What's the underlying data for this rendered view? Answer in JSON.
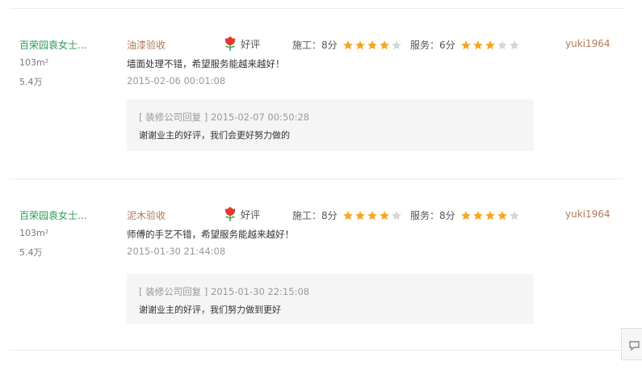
{
  "reviews": [
    {
      "owner_name": "百荣园袁女士...",
      "area": "103m²",
      "budget": "5.4万",
      "stage": "油漆验收",
      "rating_icon": "flower-icon",
      "rating_label": "好评",
      "construction": {
        "label": "施工：8分",
        "stars": 4,
        "max_stars": 5
      },
      "service": {
        "label": "服务：6分",
        "stars": 3,
        "max_stars": 5
      },
      "username": "yuki1964",
      "content": "墙面处理不错，希望服务能越来越好！",
      "time": "2015-02-06 00:01:08",
      "reply": {
        "head": "[ 装修公司回复 ] 2015-02-07 00:50:28",
        "text": "谢谢业主的好评，我们会更好努力做的"
      }
    },
    {
      "owner_name": "百荣园袁女士...",
      "area": "103m²",
      "budget": "5.4万",
      "stage": "泥木验收",
      "rating_icon": "flower-icon",
      "rating_label": "好评",
      "construction": {
        "label": "施工：8分",
        "stars": 4,
        "max_stars": 5
      },
      "service": {
        "label": "服务：8分",
        "stars": 4,
        "max_stars": 5
      },
      "username": "yuki1964",
      "content": "师傅的手艺不错，希望服务能越来越好！",
      "time": "2015-01-30 21:44:08",
      "reply": {
        "head": "[ 装修公司回复 ] 2015-01-30 22:15:08",
        "text": "谢谢业主的好评，我们努力做到更好"
      }
    }
  ],
  "colors": {
    "star_on": "#f5a623",
    "star_off": "#d6d6d6",
    "flower": "#e23b2e",
    "leaf": "#3aa14a"
  },
  "side_widget": {
    "icon": "chat-icon"
  }
}
